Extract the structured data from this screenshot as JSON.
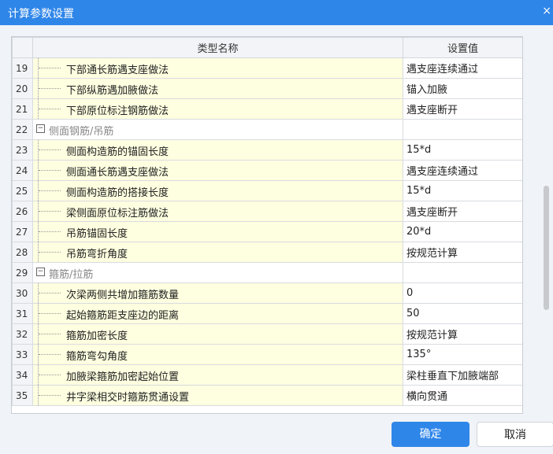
{
  "window": {
    "title": "计算参数设置",
    "close_glyph": "×"
  },
  "table": {
    "headers": {
      "name": "类型名称",
      "value": "设置值"
    },
    "rows": [
      {
        "idx": "19",
        "name": "下部通长筋遇支座做法",
        "value": "遇支座连续通过",
        "group": false
      },
      {
        "idx": "20",
        "name": "下部纵筋遇加腋做法",
        "value": "锚入加腋",
        "group": false
      },
      {
        "idx": "21",
        "name": "下部原位标注钢筋做法",
        "value": "遇支座断开",
        "group": false
      },
      {
        "idx": "22",
        "name": "侧面钢筋/吊筋",
        "value": "",
        "group": true
      },
      {
        "idx": "23",
        "name": "侧面构造筋的锚固长度",
        "value": "15*d",
        "group": false
      },
      {
        "idx": "24",
        "name": "侧面通长筋遇支座做法",
        "value": "遇支座连续通过",
        "group": false
      },
      {
        "idx": "25",
        "name": "侧面构造筋的搭接长度",
        "value": "15*d",
        "group": false
      },
      {
        "idx": "26",
        "name": "梁侧面原位标注筋做法",
        "value": "遇支座断开",
        "group": false
      },
      {
        "idx": "27",
        "name": "吊筋锚固长度",
        "value": "20*d",
        "group": false
      },
      {
        "idx": "28",
        "name": "吊筋弯折角度",
        "value": "按规范计算",
        "group": false
      },
      {
        "idx": "29",
        "name": "箍筋/拉筋",
        "value": "",
        "group": true
      },
      {
        "idx": "30",
        "name": "次梁两侧共增加箍筋数量",
        "value": "0",
        "group": false
      },
      {
        "idx": "31",
        "name": "起始箍筋距支座边的距离",
        "value": "50",
        "group": false
      },
      {
        "idx": "32",
        "name": "箍筋加密长度",
        "value": "按规范计算",
        "group": false
      },
      {
        "idx": "33",
        "name": "箍筋弯勾角度",
        "value": "135°",
        "group": false
      },
      {
        "idx": "34",
        "name": "加腋梁箍筋加密起始位置",
        "value": "梁柱垂直下加腋端部",
        "group": false
      },
      {
        "idx": "35",
        "name": "井字梁相交时箍筋贯通设置",
        "value": "横向贯通",
        "group": false
      }
    ]
  },
  "buttons": {
    "ok": "确定",
    "cancel": "取消"
  },
  "colors": {
    "accent": "#2f86e9",
    "name_cell_bg": "#fefee0"
  }
}
